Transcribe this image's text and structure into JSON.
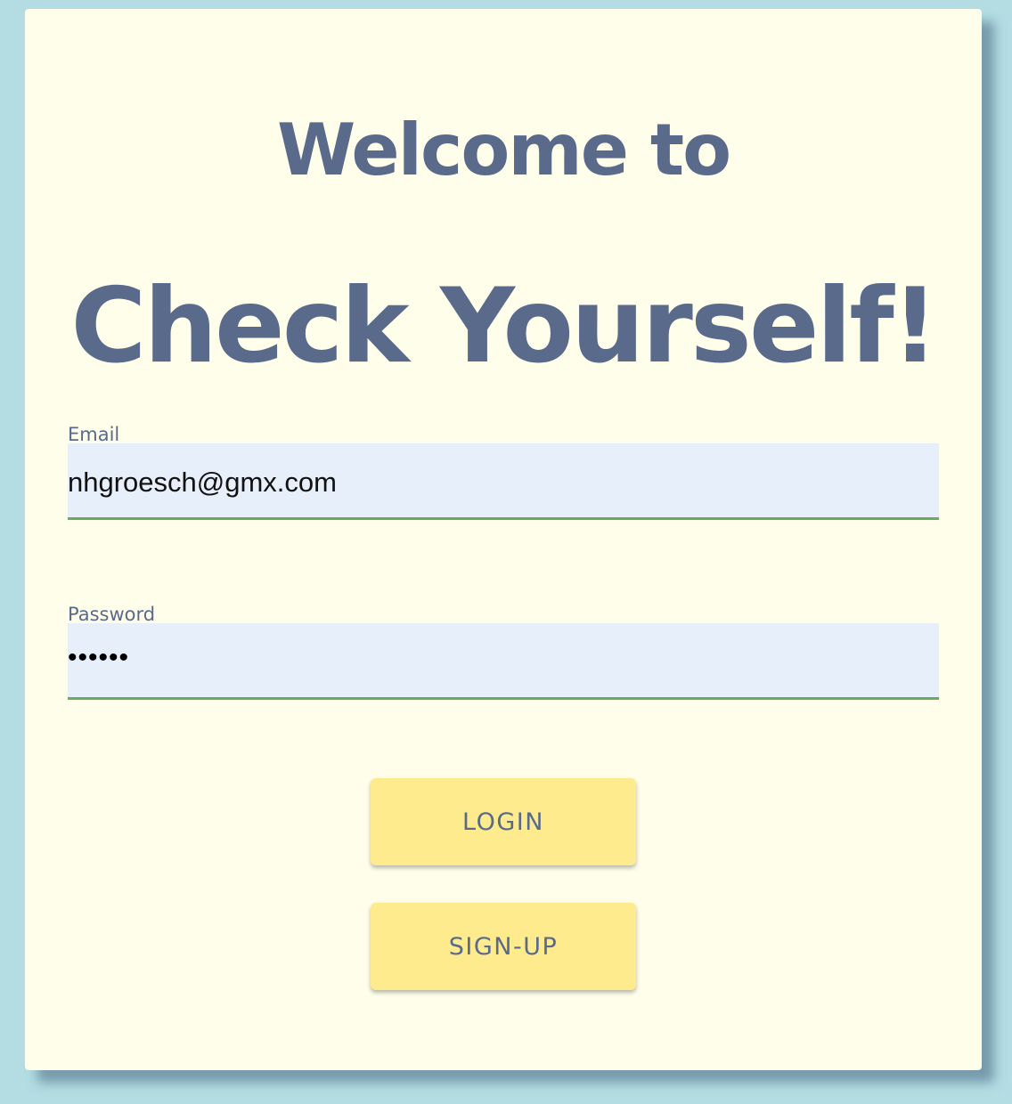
{
  "header": {
    "welcome": "Welcome to",
    "brand": "Check Yourself!"
  },
  "form": {
    "email_label": "Email",
    "email_value": "nhgroesch@gmx.com",
    "password_label": "Password",
    "password_value": "••••••"
  },
  "buttons": {
    "login": "LOGIN",
    "signup": "SIGN-UP"
  },
  "colors": {
    "page_background": "#b3dde3",
    "card_background": "#fffeea",
    "heading_text": "#5a6a8b",
    "input_background": "#e7effb",
    "input_underline": "#68ad5e",
    "button_background": "#fdeb8d"
  }
}
